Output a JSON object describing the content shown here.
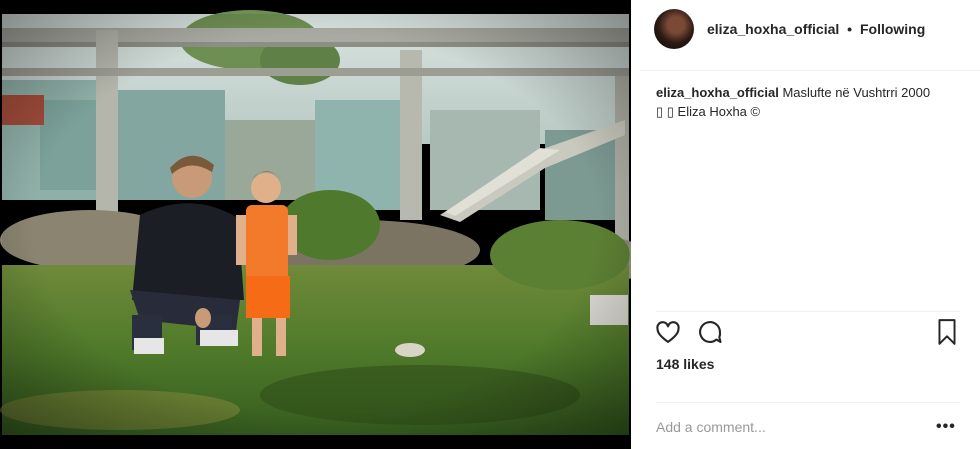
{
  "post": {
    "username": "eliza_hoxha_official",
    "separator": "•",
    "follow_status": "Following",
    "caption_user": "eliza_hoxha_official",
    "caption_line1": "Maslufte në Vushtrri 2000",
    "caption_line2": "▯ ▯ Eliza Hoxha ©",
    "likes": "148 likes",
    "comment_placeholder": "Add a comment...",
    "more_label": "•••"
  },
  "icons": {
    "like": "heart-icon",
    "comment": "comment-bubble-icon",
    "save": "bookmark-icon",
    "avatar": "profile-avatar"
  },
  "colors": {
    "text": "#262626",
    "muted": "#999999",
    "divider": "#efefef"
  }
}
